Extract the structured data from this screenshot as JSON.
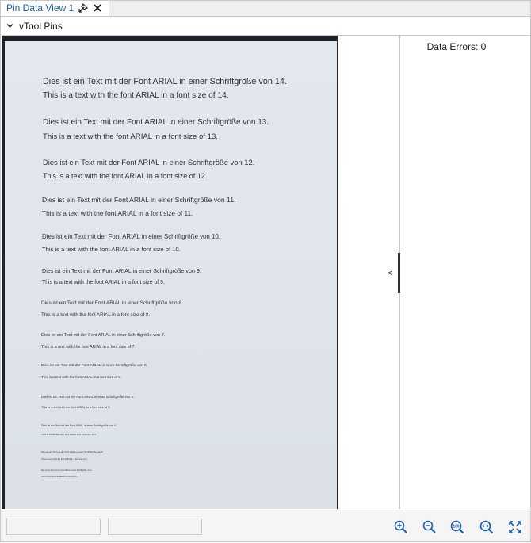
{
  "tab": {
    "label": "Pin Data View 1",
    "pin_icon": "pin-icon",
    "close_icon": "close-icon"
  },
  "section": {
    "title": "vTool Pins",
    "chevron_icon": "chevron-down-icon"
  },
  "data_errors": "Data Errors: 0",
  "splitter": {
    "collapse_left": "<",
    "collapse_right": ">"
  },
  "image_lines": [
    "Dies ist ein Text mit der Font ARIAL in einer Schriftgröße von 14.",
    "This is a text with the font ARIAL in a font size of 14.",
    "Dies ist ein Text mit der Font ARIAL in einer Schriftgröße von 13.",
    "This is a text with the font ARIAL in a font size of 13.",
    "Dies ist ein Text mit der Font ARIAL in einer Schriftgröße von 12.",
    "This is a text with the font ARIAL in a font size of 12.",
    "Dies ist ein Text mit der Font ARIAL in einer Schriftgröße von 11.",
    "This is a text with the font ARIAL in a font size of 11.",
    "Dies ist ein Text mit der Font ARIAL in einer Schriftgröße von 10.",
    "This is a text with the font ARIAL in a font size of 10.",
    "Dies ist ein Text mit der Font ARIAL in einer Schriftgröße von 9.",
    "This is a text with the font ARIAL in a font size of 9.",
    "Dies ist ein Text mit der Font ARIAL in einer Schriftgröße von 8.",
    "This is a text with the font ARIAL in a font size of 8.",
    "Dies ist ein Text mit der Font ARIAL in einer Schriftgröße von 7.",
    "This is a text with the font ARIAL in a font size of 7.",
    "Dies ist ein Text mit der Font ARIAL in einer Schriftgröße von 6.",
    "This is a text with the font ARIAL in a font size of 6.",
    "Dies ist ein Text mit der Font ARIAL in einer Schriftgröße von 5.",
    "This is a text with the font ARIAL in a font size of 5.",
    "Dies ist ein Text mit der Font ARIAL in einer Schriftgröße von 4.",
    "This is a text with the font ARIAL in a font size of 4.",
    "Dies ist ein Text mit der Font ARIAL in einer Schriftgröße von 3.",
    "This is a text with the font ARIAL in a font size of 3.",
    "Dies ist ein Text mit der Font ARIAL in einer Schriftgröße von 2.",
    "This is a text with the font ARIAL in a font size of 2."
  ],
  "status_fields": [
    "",
    ""
  ],
  "toolbar": {
    "zoom_in_icon": "zoom-in-icon",
    "zoom_out_icon": "zoom-out-icon",
    "zoom_100_icon": "zoom-100-icon",
    "zoom_100_label": "100",
    "zoom_fit_width_icon": "zoom-fit-width-icon",
    "fit_to_window_icon": "fit-to-window-icon"
  }
}
